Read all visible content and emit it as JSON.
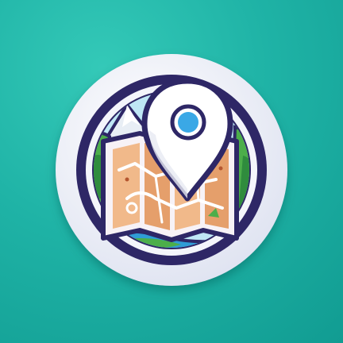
{
  "icon": {
    "name": "map-location-icon",
    "kind": "app-icon"
  },
  "colors": {
    "background": "#1fb3a6",
    "background_light": "#3fd0bf",
    "background_dark": "#0f968d",
    "badge_rim": "#f2f4fa",
    "badge_outline": "#2e2766",
    "sky": "#bfe7f5",
    "mountain": "#e8eef5",
    "foliage": "#4cae4a",
    "foliage_dark": "#2f8c3d",
    "map_paper": "#f1b98a",
    "map_paper_shade": "#e59f6b",
    "map_border": "#f7f2f6",
    "water": "#2f9cd6",
    "pin_body": "#ffffff",
    "pin_outline": "#2e2766",
    "pin_dot": "#3aa8e6"
  }
}
